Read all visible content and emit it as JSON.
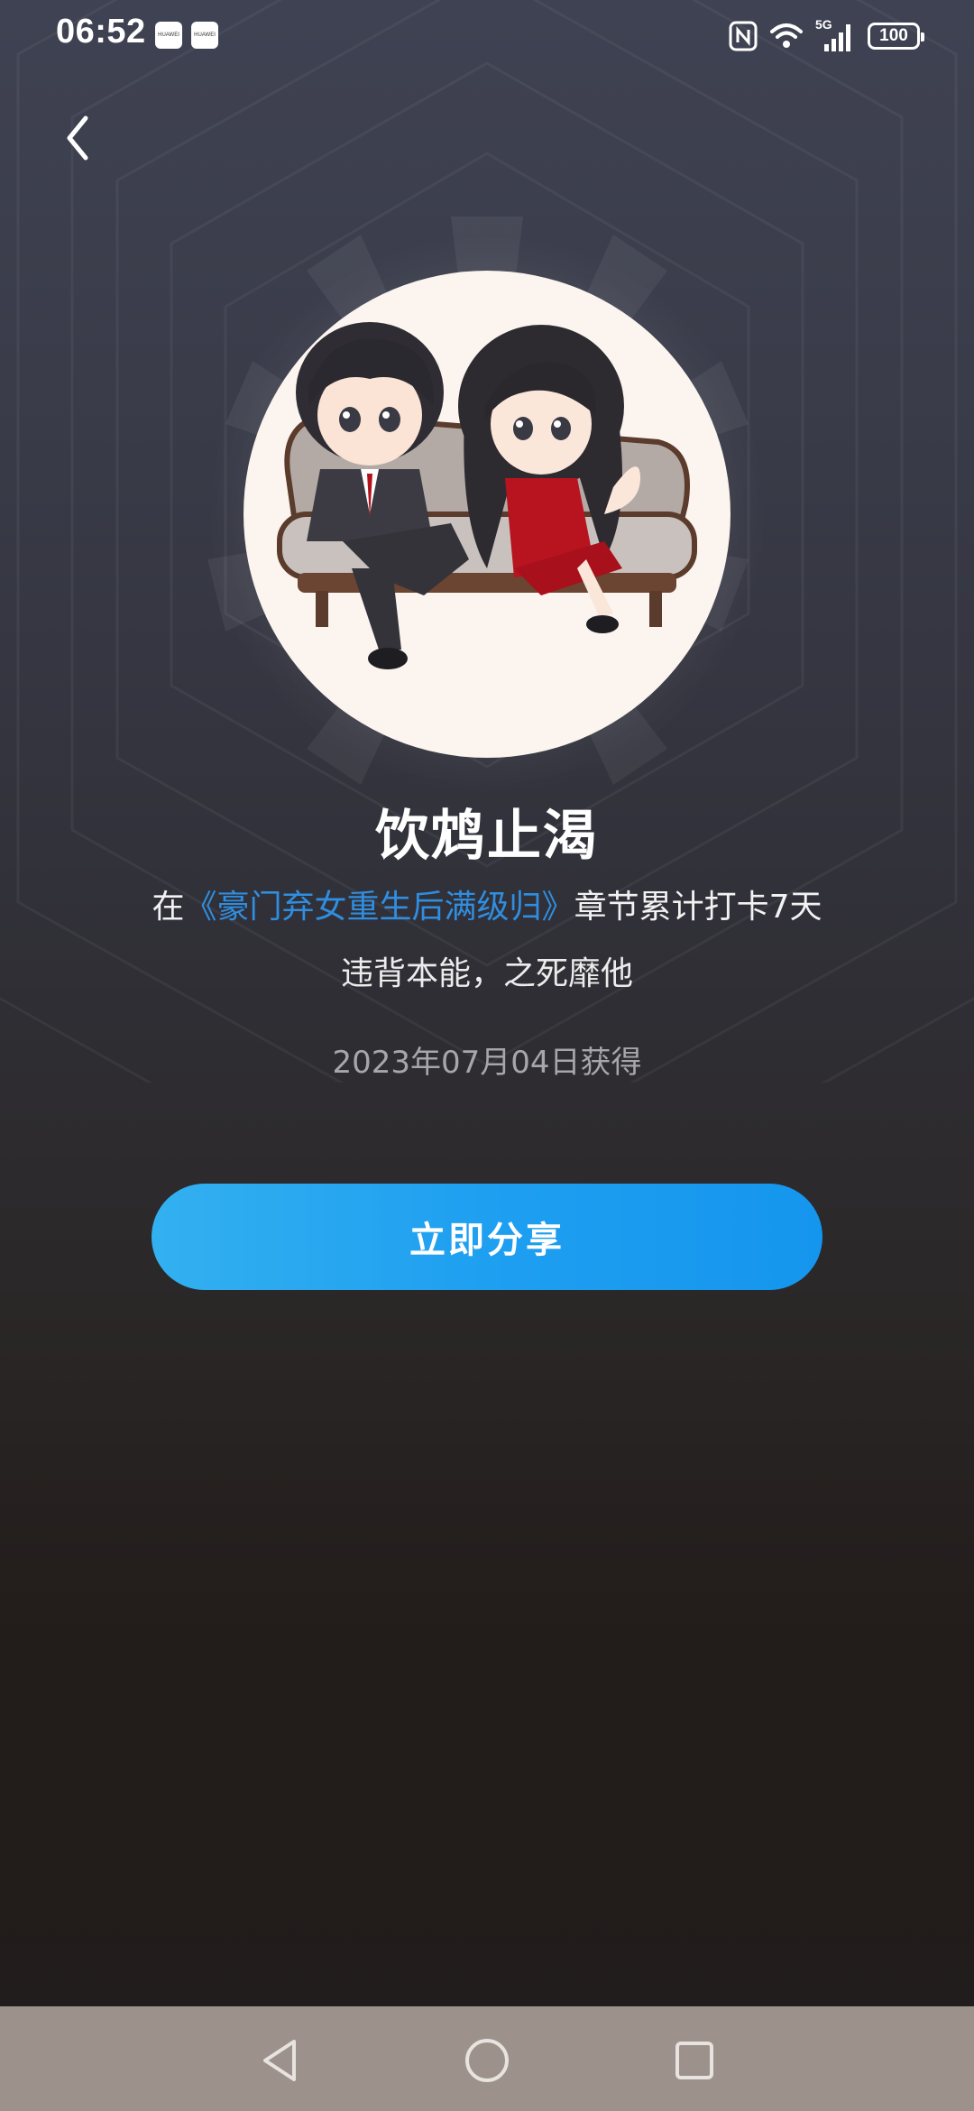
{
  "status_bar": {
    "time": "06:52",
    "notification_apps": [
      "HUAWEI",
      "HUAWEI"
    ],
    "network": "5G",
    "battery": "100"
  },
  "header": {
    "back_icon": "chevron-left-icon"
  },
  "badge": {
    "title": "饮鸩止渴",
    "desc_prefix": "在",
    "book_title": "《豪门弃女重生后满级归》",
    "desc_suffix": "章节累计打卡7天",
    "quote": "违背本能，之死靡他",
    "acquired_date": "2023年07月04日获得"
  },
  "actions": {
    "share_label": "立即分享"
  },
  "nav_bar": {
    "back": "triangle-back-icon",
    "home": "circle-home-icon",
    "recents": "square-recents-icon"
  },
  "colors": {
    "accent": "#1e9ff0",
    "link": "#2f8ee0",
    "nav_bar": "#9c928b"
  }
}
